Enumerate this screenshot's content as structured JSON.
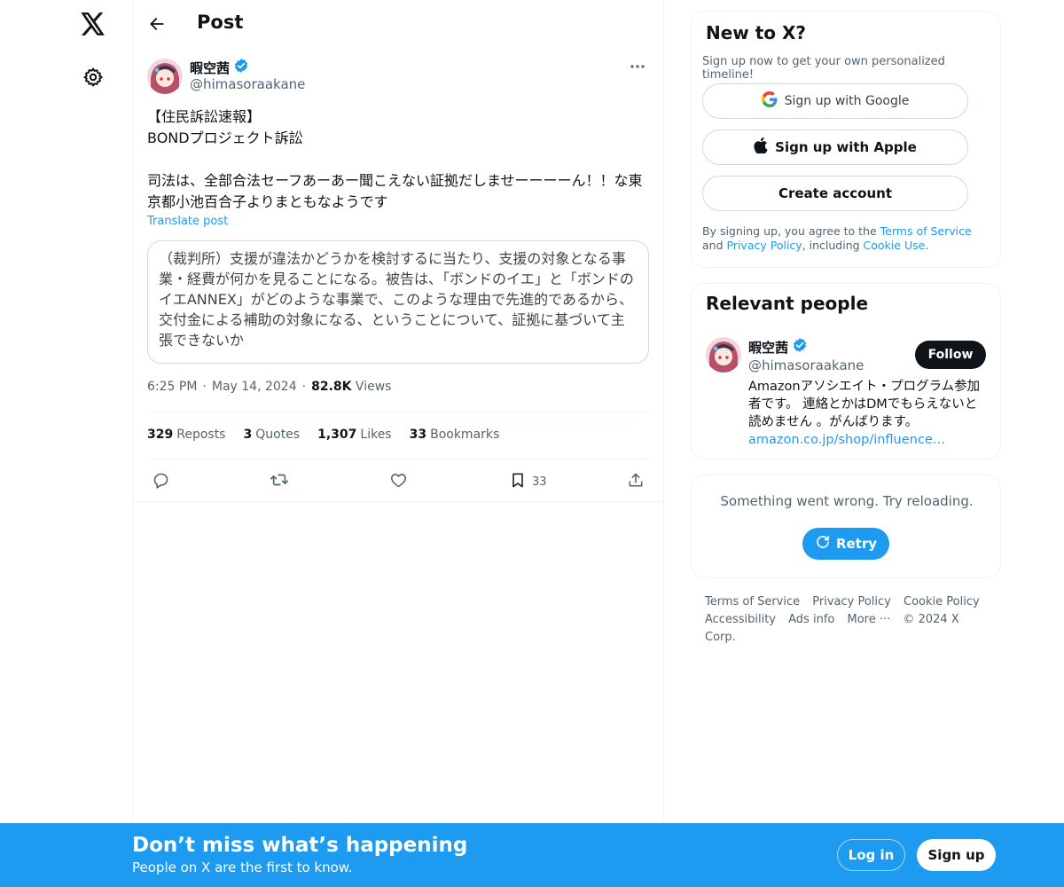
{
  "header": {
    "title": "Post"
  },
  "post": {
    "author_name": "暇空茜",
    "author_handle": "@himasoraakane",
    "text": "【住民訴訟速報】\nBONDプロジェクト訴訟\n\n司法は、全部合法セーフあーあー聞こえない証拠だしませーーーーん！！な東京都小池百合子よりまともなようです",
    "translate_label": "Translate post",
    "quote_text": "（裁判所）支援が違法かどうかを検討するに当たり、支援の対象となる事業・経費が何かを見ることになる。被告は、「ボンドのイエ」と「ボンドのイエANNEX」がどのような事業で、このような理由で先進的であるから、交付金による補助の対象になる、ということについて、証拠に基づいて主張できないか",
    "time": "6:25 PM",
    "date": "May 14, 2024",
    "views_count": "82.8K",
    "views_label": "Views",
    "sep": "·",
    "stats": {
      "reposts_count": "329",
      "reposts_label": "Reposts",
      "quotes_count": "3",
      "quotes_label": "Quotes",
      "likes_count": "1,307",
      "likes_label": "Likes",
      "bookmarks_count": "33",
      "bookmarks_label": "Bookmarks"
    },
    "bookmark_action_count": "33"
  },
  "new_to_x": {
    "title": "New to X?",
    "subtitle": "Sign up now to get your own personalized timeline!",
    "google_label": "Sign up with Google",
    "apple_label": "Sign up with Apple",
    "create_label": "Create account",
    "legal_prefix": "By signing up, you agree to the ",
    "terms_link": "Terms of Service",
    "legal_and": " and ",
    "privacy_link": "Privacy Policy",
    "legal_including": ", including ",
    "cookie_link": "Cookie Use",
    "legal_end": "."
  },
  "relevant": {
    "title": "Relevant people",
    "name": "暇空茜",
    "handle": "@himasoraakane",
    "follow_label": "Follow",
    "bio": "Amazonアソシエイト・プログラム参加者です。 連絡とかはDMでもらえないと読めません 。がんばります。",
    "bio_link": "amazon.co.jp/shop/influence…"
  },
  "error_card": {
    "message": "Something went wrong. Try reloading.",
    "retry_label": "Retry"
  },
  "footer": {
    "terms": "Terms of Service",
    "privacy": "Privacy Policy",
    "cookie": "Cookie Policy",
    "accessibility": "Accessibility",
    "ads": "Ads info",
    "more": "More ···",
    "copyright": "© 2024 X Corp."
  },
  "bottom_bar": {
    "title": "Don’t miss what’s happening",
    "subtitle": "People on X are the first to know.",
    "login_label": "Log in",
    "signup_label": "Sign up"
  },
  "colors": {
    "accent": "#1d9bf0",
    "text": "#0f1419",
    "muted": "#536471",
    "border": "#eff3f4"
  },
  "icons": [
    "x-logo-icon",
    "gear-icon",
    "back-arrow-icon",
    "verified-badge-icon",
    "more-icon",
    "reply-icon",
    "repost-icon",
    "like-icon",
    "bookmark-icon",
    "share-icon",
    "google-icon",
    "apple-icon",
    "refresh-icon"
  ]
}
